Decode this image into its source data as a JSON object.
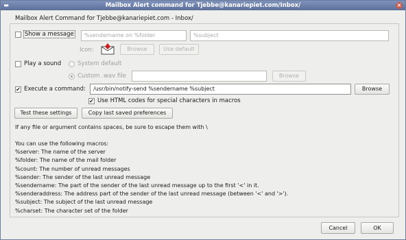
{
  "window": {
    "title": "Mailbox Alert command for Tjebbe@kanariepiet.com/Inbox/"
  },
  "group": {
    "title": "Mailbox Alert Command for Tjebbe@kanariepiet.com - Inbox/"
  },
  "show_message": {
    "label": "Show a message",
    "checked": false,
    "sender_placeholder": "%sendername on %folder",
    "subject_placeholder": "%subject",
    "icon_label": "Icon:",
    "browse_label": "Browse",
    "default_label": "Use default"
  },
  "play_sound": {
    "label": "Play a sound",
    "checked": false,
    "system_default_label": "System default",
    "custom_label": "Custom .wav file",
    "browse_label": "Browse"
  },
  "execute": {
    "label": "Execute a command:",
    "checked": true,
    "command": "/usr/bin/notify-send %sendername %subject",
    "browse_label": "Browse",
    "html_codes_label": "Use HTML codes for special characters in macros",
    "html_codes_checked": true
  },
  "actions": {
    "test_label": "Test these settings",
    "copy_label": "Copy last saved preferences"
  },
  "help": {
    "escape_note": "If any file or argument contains spaces, be sure to escape them with \\",
    "macros_intro": "You can use the following macros:",
    "macros": [
      "%server: The name of the server",
      "%folder: The name of the mail folder",
      "%count: The number of unread messages",
      "%sender: The sender of the last unread message",
      "%sendername: The part of the sender of the last unread message up to the first '<' in it.",
      "%senderaddress: The address part of the sender of the last unread message (between '<' and '>').",
      "%subject: The subject of the last unread message",
      "%charset: The character set of the folder"
    ]
  },
  "footer": {
    "cancel_label": "Cancel",
    "ok_label": "OK"
  }
}
